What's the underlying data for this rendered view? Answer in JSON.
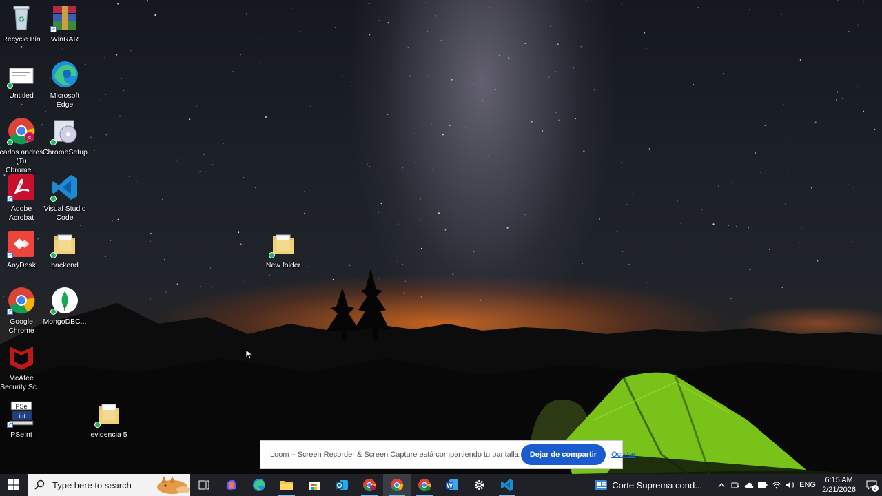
{
  "desktop_icons": [
    {
      "label": "Recycle Bin",
      "icon": "recycle-bin-icon"
    },
    {
      "label": "WinRAR",
      "icon": "winrar-icon"
    },
    {
      "label": "Untitled",
      "icon": "document-icon"
    },
    {
      "label": "Microsoft Edge",
      "icon": "edge-icon"
    },
    {
      "label": "carlos andres (Tu Chrome...",
      "icon": "chrome-profile-icon"
    },
    {
      "label": "ChromeSetup",
      "icon": "chrome-setup-icon"
    },
    {
      "label": "Adobe Acrobat",
      "icon": "acrobat-icon"
    },
    {
      "label": "Visual Studio Code",
      "icon": "vscode-icon"
    },
    {
      "label": "AnyDesk",
      "icon": "anydesk-icon"
    },
    {
      "label": "backend",
      "icon": "folder-icon"
    },
    {
      "label": "Google Chrome",
      "icon": "chrome-icon"
    },
    {
      "label": "MongoDBC...",
      "icon": "mongodb-icon"
    },
    {
      "label": "McAfee Security Sc...",
      "icon": "mcafee-icon"
    },
    {
      "label": "PSeInt",
      "icon": "pseint-icon"
    },
    {
      "label": "evidencia 5",
      "icon": "folder-icon"
    },
    {
      "label": "New folder",
      "icon": "folder-icon"
    }
  ],
  "loom_bar": {
    "message": "Loom – Screen Recorder & Screen Capture está compartiendo tu pantalla.",
    "stop_label": "Dejar de compartir",
    "hide_label": "Ocultar",
    "accent": "#1a5cd0"
  },
  "taskbar": {
    "search_placeholder": "Type here to search",
    "apps": [
      "task-view",
      "copilot",
      "edge",
      "file-explorer",
      "microsoft-store",
      "outlook",
      "chrome-profile",
      "chrome",
      "chrome-alt",
      "word",
      "settings",
      "vscode"
    ],
    "news_label": "Corte Suprema cond...",
    "language": "ENG",
    "time": "6:15 AM",
    "date": "2/21/2026",
    "notification_count": "2"
  }
}
